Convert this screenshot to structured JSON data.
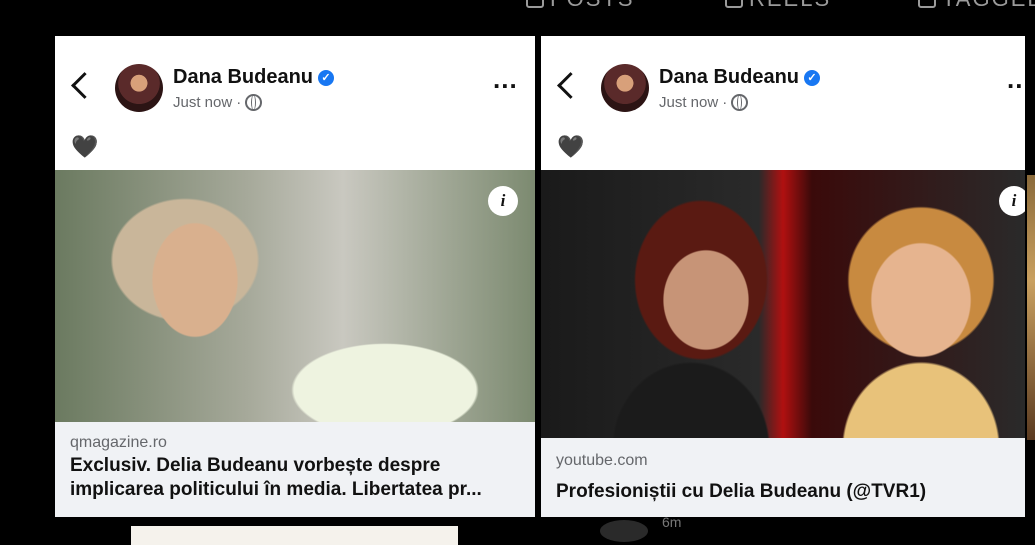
{
  "top_tabs": [
    {
      "label": "POSTS",
      "icon": "grid-icon"
    },
    {
      "label": "REELS",
      "icon": "reels-icon"
    },
    {
      "label": "TAGGED",
      "icon": "tagged-icon"
    }
  ],
  "posts": [
    {
      "author": "Dana Budeanu",
      "time": "Just now",
      "emoji": "🖤",
      "link_domain": "qmagazine.ro",
      "link_title": "Exclusiv. Delia Budeanu vorbește despre implicarea politicului în media. Libertatea pr...",
      "info_label": "i"
    },
    {
      "author": "Dana Budeanu",
      "time": "Just now",
      "emoji": "🖤",
      "link_domain": "youtube.com",
      "link_title": "Profesioniștii cu Delia Budeanu (@TVR1)",
      "info_label": "i"
    }
  ],
  "bg_post": {
    "time": "6m"
  }
}
